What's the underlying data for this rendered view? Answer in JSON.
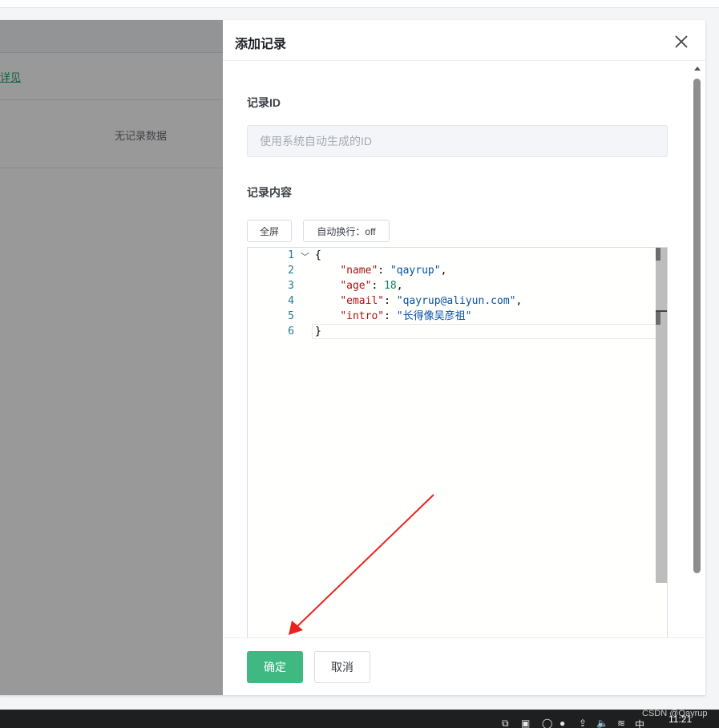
{
  "background": {
    "link_text": "详见",
    "empty_text": "无记录数据"
  },
  "dialog": {
    "title": "添加记录",
    "close_icon": "close-icon",
    "id_field": {
      "label": "记录ID",
      "placeholder": "使用系统自动生成的ID",
      "value": ""
    },
    "content_field": {
      "label": "记录内容",
      "fullscreen_button": "全屏",
      "wrap_button": "自动换行：off"
    },
    "editor": {
      "line_numbers": [
        "1",
        "2",
        "3",
        "4",
        "5",
        "6"
      ],
      "lines": [
        {
          "parts": [
            {
              "t": "p",
              "v": "{"
            }
          ]
        },
        {
          "parts": [
            {
              "t": "p",
              "v": "    "
            },
            {
              "t": "k",
              "v": "\"name\""
            },
            {
              "t": "p",
              "v": ": "
            },
            {
              "t": "s",
              "v": "\"qayrup\""
            },
            {
              "t": "p",
              "v": ","
            }
          ]
        },
        {
          "parts": [
            {
              "t": "p",
              "v": "    "
            },
            {
              "t": "k",
              "v": "\"age\""
            },
            {
              "t": "p",
              "v": ": "
            },
            {
              "t": "n",
              "v": "18"
            },
            {
              "t": "p",
              "v": ","
            }
          ]
        },
        {
          "parts": [
            {
              "t": "p",
              "v": "    "
            },
            {
              "t": "k",
              "v": "\"email\""
            },
            {
              "t": "p",
              "v": ": "
            },
            {
              "t": "s",
              "v": "\"qayrup@aliyun.com\""
            },
            {
              "t": "p",
              "v": ","
            }
          ]
        },
        {
          "parts": [
            {
              "t": "p",
              "v": "    "
            },
            {
              "t": "k",
              "v": "\"intro\""
            },
            {
              "t": "p",
              "v": ": "
            },
            {
              "t": "s",
              "v": "\"长得像吴彦祖\""
            }
          ]
        },
        {
          "parts": [
            {
              "t": "p",
              "v": "}"
            }
          ]
        }
      ]
    },
    "footer": {
      "confirm": "确定",
      "cancel": "取消"
    }
  },
  "annotation": {
    "arrow_color": "#e8231e"
  },
  "taskbar": {
    "watermark": "CSDN @Qayrup",
    "clock": "11:21",
    "ime": "中"
  },
  "colors": {
    "accent": "#3fb882",
    "link": "#16a36b",
    "json_key": "#a31515",
    "json_string": "#0451a5",
    "json_number": "#098658"
  }
}
